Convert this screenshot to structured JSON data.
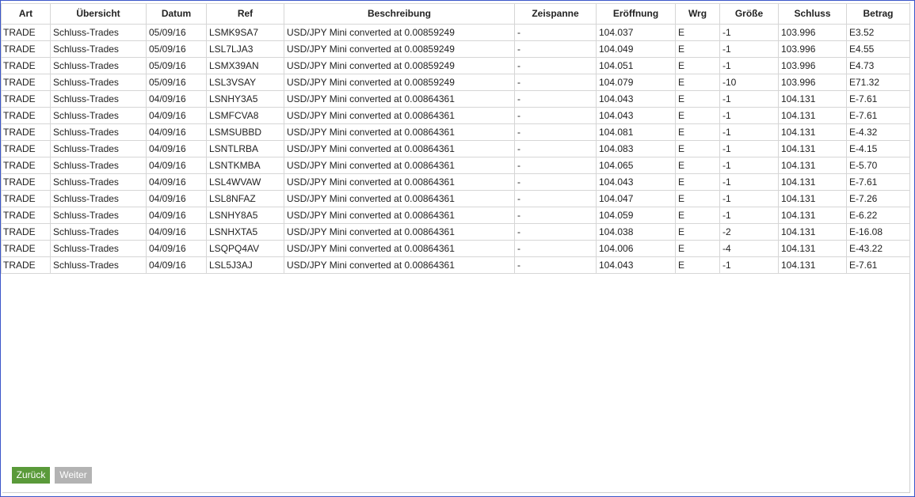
{
  "table": {
    "headers": [
      "Art",
      "Übersicht",
      "Datum",
      "Ref",
      "Beschreibung",
      "Zeispanne",
      "Eröffnung",
      "Wrg",
      "Größe",
      "Schluss",
      "Betrag"
    ],
    "rows": [
      [
        "TRADE",
        "Schluss-Trades",
        "05/09/16",
        "LSMK9SA7",
        "USD/JPY Mini converted at 0.00859249",
        "-",
        "104.037",
        "E",
        "-1",
        "103.996",
        "E3.52"
      ],
      [
        "TRADE",
        "Schluss-Trades",
        "05/09/16",
        "LSL7LJA3",
        "USD/JPY Mini converted at 0.00859249",
        "-",
        "104.049",
        "E",
        "-1",
        "103.996",
        "E4.55"
      ],
      [
        "TRADE",
        "Schluss-Trades",
        "05/09/16",
        "LSMX39AN",
        "USD/JPY Mini converted at 0.00859249",
        "-",
        "104.051",
        "E",
        "-1",
        "103.996",
        "E4.73"
      ],
      [
        "TRADE",
        "Schluss-Trades",
        "05/09/16",
        "LSL3VSAY",
        "USD/JPY Mini converted at 0.00859249",
        "-",
        "104.079",
        "E",
        "-10",
        "103.996",
        "E71.32"
      ],
      [
        "TRADE",
        "Schluss-Trades",
        "04/09/16",
        "LSNHY3A5",
        "USD/JPY Mini converted at 0.00864361",
        "-",
        "104.043",
        "E",
        "-1",
        "104.131",
        "E-7.61"
      ],
      [
        "TRADE",
        "Schluss-Trades",
        "04/09/16",
        "LSMFCVA8",
        "USD/JPY Mini converted at 0.00864361",
        "-",
        "104.043",
        "E",
        "-1",
        "104.131",
        "E-7.61"
      ],
      [
        "TRADE",
        "Schluss-Trades",
        "04/09/16",
        "LSMSUBBD",
        "USD/JPY Mini converted at 0.00864361",
        "-",
        "104.081",
        "E",
        "-1",
        "104.131",
        "E-4.32"
      ],
      [
        "TRADE",
        "Schluss-Trades",
        "04/09/16",
        "LSNTLRBA",
        "USD/JPY Mini converted at 0.00864361",
        "-",
        "104.083",
        "E",
        "-1",
        "104.131",
        "E-4.15"
      ],
      [
        "TRADE",
        "Schluss-Trades",
        "04/09/16",
        "LSNTKMBA",
        "USD/JPY Mini converted at 0.00864361",
        "-",
        "104.065",
        "E",
        "-1",
        "104.131",
        "E-5.70"
      ],
      [
        "TRADE",
        "Schluss-Trades",
        "04/09/16",
        "LSL4WVAW",
        "USD/JPY Mini converted at 0.00864361",
        "-",
        "104.043",
        "E",
        "-1",
        "104.131",
        "E-7.61"
      ],
      [
        "TRADE",
        "Schluss-Trades",
        "04/09/16",
        "LSL8NFAZ",
        "USD/JPY Mini converted at 0.00864361",
        "-",
        "104.047",
        "E",
        "-1",
        "104.131",
        "E-7.26"
      ],
      [
        "TRADE",
        "Schluss-Trades",
        "04/09/16",
        "LSNHY8A5",
        "USD/JPY Mini converted at 0.00864361",
        "-",
        "104.059",
        "E",
        "-1",
        "104.131",
        "E-6.22"
      ],
      [
        "TRADE",
        "Schluss-Trades",
        "04/09/16",
        "LSNHXTA5",
        "USD/JPY Mini converted at 0.00864361",
        "-",
        "104.038",
        "E",
        "-2",
        "104.131",
        "E-16.08"
      ],
      [
        "TRADE",
        "Schluss-Trades",
        "04/09/16",
        "LSQPQ4AV",
        "USD/JPY Mini converted at 0.00864361",
        "-",
        "104.006",
        "E",
        "-4",
        "104.131",
        "E-43.22"
      ],
      [
        "TRADE",
        "Schluss-Trades",
        "04/09/16",
        "LSL5J3AJ",
        "USD/JPY Mini converted at 0.00864361",
        "-",
        "104.043",
        "E",
        "-1",
        "104.131",
        "E-7.61"
      ]
    ]
  },
  "pagination": {
    "back_label": "Zurück",
    "next_label": "Weiter"
  },
  "colors": {
    "back_button": "#5a9a3a",
    "next_button_disabled": "#b3b3b3",
    "frame_border": "#3b56c9"
  }
}
